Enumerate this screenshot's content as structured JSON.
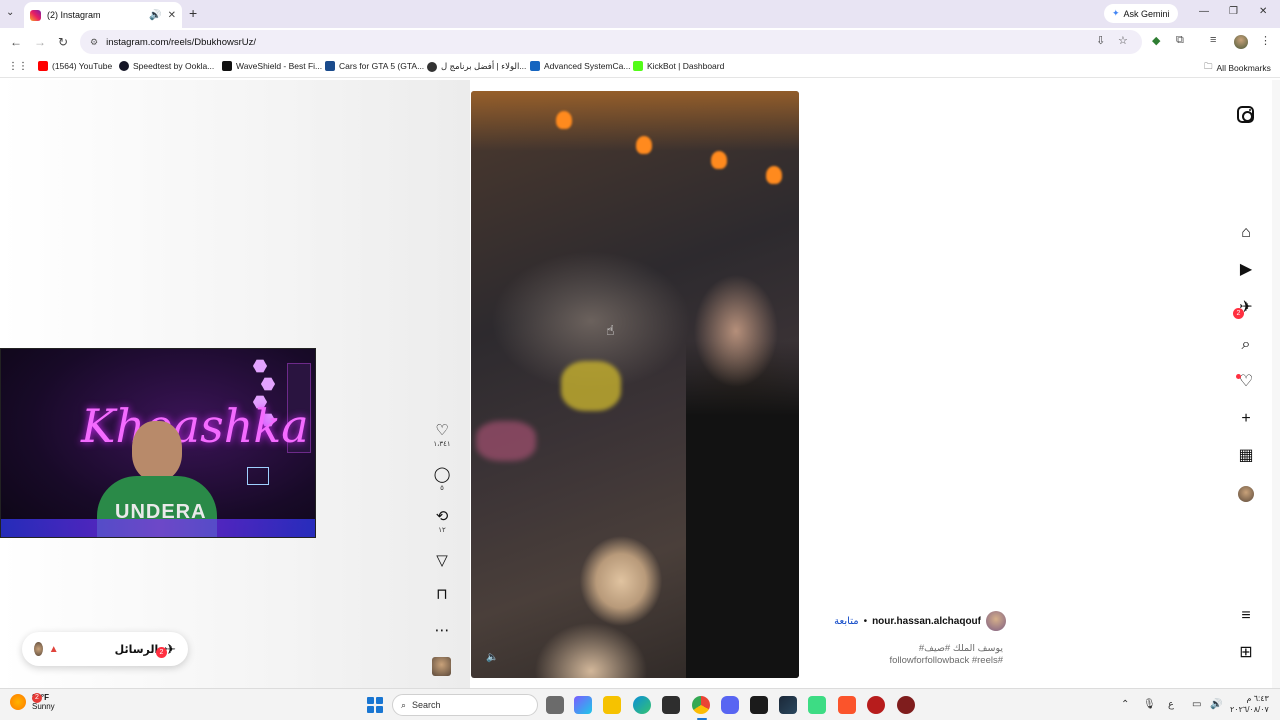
{
  "browser": {
    "tab_title": "(2) Instagram",
    "url": "instagram.com/reels/DbukhowsrUz/",
    "gemini_label": "Ask Gemini",
    "bookmarks": [
      {
        "label": "(1564) YouTube",
        "color": "#ff0000"
      },
      {
        "label": "Speedtest by Ookla...",
        "color": "#141526"
      },
      {
        "label": "WaveShield - Best Fi...",
        "color": "#111111"
      },
      {
        "label": "Cars for GTA 5 (GTA...",
        "color": "#1a4b8c"
      },
      {
        "label": "الولاء | أفضل برنامج ل...",
        "color": "#333333"
      },
      {
        "label": "Advanced SystemCa...",
        "color": "#1565c0"
      },
      {
        "label": "KickBot | Dashboard",
        "color": "#53fc18"
      }
    ],
    "all_bookmarks": "All Bookmarks"
  },
  "reel": {
    "likes": "١،٣٤١",
    "comments": "٥",
    "reposts": "١٢",
    "author": "nour.hassan.alchaqouf",
    "follow_label": "متابعة",
    "separator": "•",
    "caption_line1": "#يوسف الملك #صيف",
    "caption_line2": "followforfollowback #reels#"
  },
  "stream_overlay": {
    "neon_text": "Khoashka",
    "shirt_text": "UNDERA"
  },
  "messages": {
    "label": "الرسائل",
    "badge": "2"
  },
  "ig_nav": {
    "dm_badge": "2"
  },
  "taskbar": {
    "weather_badge": "2",
    "temp": "84°F",
    "condition": "Sunny",
    "search": "Search",
    "time": "٦:٤٣ م",
    "date": "٢٠٢٦/٠٨/٠٧"
  }
}
